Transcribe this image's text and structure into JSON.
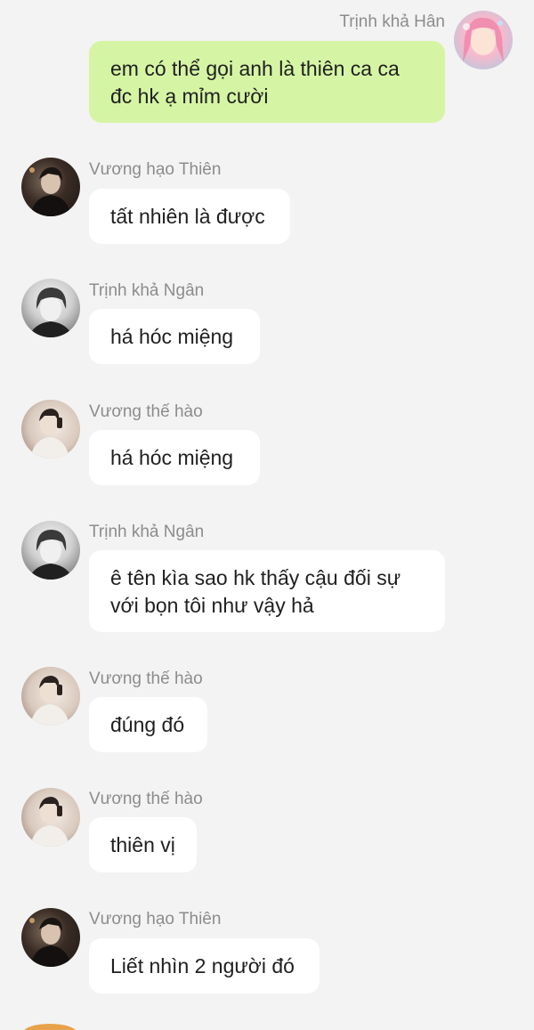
{
  "messages": [
    {
      "sender": "Trịnh khả Hân",
      "text": "em có thể gọi anh là thiên ca ca đc hk ạ mỉm cười",
      "self": true
    },
    {
      "sender": "Vương hạo Thiên",
      "text": "tất nhiên là được"
    },
    {
      "sender": "Trịnh khả Ngân",
      "text": "há hóc miệng"
    },
    {
      "sender": "Vương thế hào",
      "text": "há hóc miệng"
    },
    {
      "sender": "Trịnh khả Ngân",
      "text": "ê tên kìa sao hk thấy cậu đối sự với bọn tôi như vậy hả"
    },
    {
      "sender": "Vương thế hào",
      "text": "đúng đó"
    },
    {
      "sender": "Vương thế hào",
      "text": "thiên vị"
    },
    {
      "sender": "Vương hạo Thiên",
      "text": "Liết nhìn 2 người đó"
    }
  ]
}
